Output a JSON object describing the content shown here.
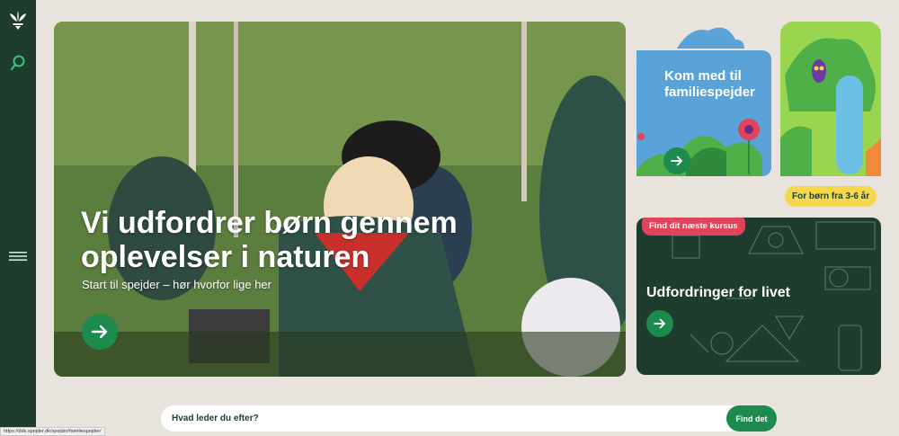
{
  "hero": {
    "title": "Vi udfordrer børn gennem oplevelser i naturen",
    "subtitle": "Start til spejder – hør hvorfor lige her"
  },
  "family_card": {
    "title": "Kom med til familiespejder",
    "badge": "For børn fra 3-6 år"
  },
  "course_card": {
    "badge": "Find dit næste kursus",
    "title": "Udfordringer for livet"
  },
  "search": {
    "placeholder": "Hvad leder du efter?",
    "button_label": "Find det"
  },
  "status_url": "https://dds.spejder.dk/spejder/familiespejder/",
  "icons": {
    "logo": "lily-logo-icon",
    "search": "search-icon",
    "menu": "menu-icon",
    "arrow": "arrow-right-icon"
  },
  "colors": {
    "sidebar": "#1e3d2f",
    "accent_green": "#1d8a4e",
    "badge_red": "#e0445a",
    "badge_yellow": "#f5d84a",
    "background": "#e8e4dd"
  }
}
